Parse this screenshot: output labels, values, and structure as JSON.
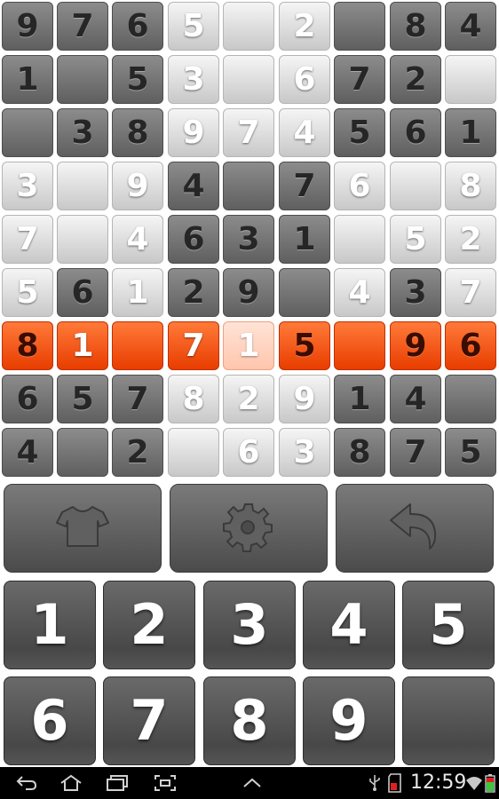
{
  "board": {
    "rows": [
      [
        "9",
        "7",
        "6",
        "5",
        "",
        "2",
        "",
        "8",
        "4"
      ],
      [
        "1",
        "",
        "5",
        "3",
        "",
        "6",
        "7",
        "2",
        ""
      ],
      [
        "",
        "3",
        "8",
        "9",
        "7",
        "4",
        "5",
        "6",
        "1"
      ],
      [
        "3",
        "",
        "9",
        "4",
        "",
        "7",
        "6",
        "",
        "8"
      ],
      [
        "7",
        "",
        "4",
        "6",
        "3",
        "1",
        "",
        "5",
        "2"
      ],
      [
        "5",
        "6",
        "1",
        "2",
        "9",
        "",
        "4",
        "3",
        "7"
      ],
      [
        "8",
        "1",
        "",
        "7",
        "1",
        "5",
        "",
        "9",
        "6"
      ],
      [
        "6",
        "5",
        "7",
        "8",
        "2",
        "9",
        "1",
        "4",
        ""
      ],
      [
        "4",
        "",
        "2",
        "",
        "6",
        "3",
        "8",
        "7",
        "5"
      ]
    ],
    "shades": [
      [
        "D",
        "D",
        "D",
        "L",
        "L",
        "L",
        "D",
        "D",
        "D"
      ],
      [
        "D",
        "D",
        "D",
        "L",
        "L",
        "L",
        "D",
        "D",
        "L"
      ],
      [
        "D",
        "D",
        "D",
        "L",
        "L",
        "L",
        "D",
        "D",
        "D"
      ],
      [
        "L",
        "L",
        "L",
        "D",
        "D",
        "D",
        "L",
        "L",
        "L"
      ],
      [
        "L",
        "L",
        "L",
        "D",
        "D",
        "D",
        "L",
        "L",
        "L"
      ],
      [
        "L",
        "D",
        "L",
        "D",
        "D",
        "D",
        "L",
        "D",
        "L"
      ],
      [
        "O",
        "O",
        "O",
        "O",
        "P",
        "O",
        "O",
        "O",
        "O"
      ],
      [
        "D",
        "D",
        "D",
        "L",
        "L",
        "L",
        "D",
        "D",
        "D"
      ],
      [
        "D",
        "D",
        "D",
        "L",
        "L",
        "L",
        "D",
        "D",
        "D"
      ]
    ],
    "highlight_row": 7,
    "selected_cell": "row 7, column 5"
  },
  "toolbar": {
    "theme_icon": "tshirt-icon",
    "settings_icon": "gear-icon",
    "undo_icon": "undo-arrow-icon"
  },
  "keypad": {
    "keys": [
      "1",
      "2",
      "3",
      "4",
      "5",
      "6",
      "7",
      "8",
      "9",
      ""
    ]
  },
  "statusbar": {
    "time": "12:59",
    "nav_icons": [
      "back-icon",
      "home-icon",
      "recent-apps-icon",
      "screenshot-icon",
      "up-chevron-icon"
    ],
    "status_icons": [
      "usb-icon",
      "sd-card-icon",
      "wifi-icon",
      "battery-icon"
    ]
  },
  "colors": {
    "dark_cell": "#6e6e6e",
    "light_cell": "#e0e0e0",
    "highlight": "#ff5a14",
    "selected": "#ffd6c4"
  }
}
